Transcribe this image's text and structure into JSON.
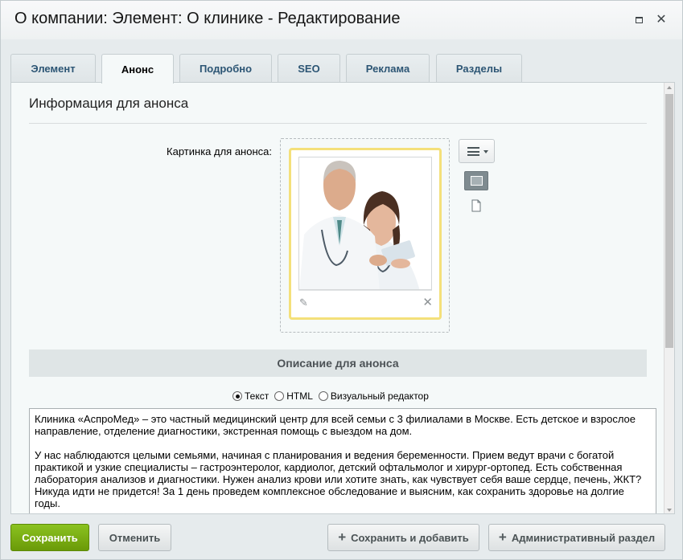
{
  "window": {
    "title": "О компании: Элемент: О клинике - Редактирование"
  },
  "tabs": [
    {
      "label": "Элемент",
      "active": false
    },
    {
      "label": "Анонс",
      "active": true
    },
    {
      "label": "Подробно",
      "active": false
    },
    {
      "label": "SEO",
      "active": false
    },
    {
      "label": "Реклама",
      "active": false
    },
    {
      "label": "Разделы",
      "active": false
    }
  ],
  "section": {
    "title": "Информация для анонса",
    "image_label": "Картинка для анонса:"
  },
  "description": {
    "header": "Описание для анонса",
    "modes": [
      {
        "label": "Текст",
        "checked": true
      },
      {
        "label": "HTML",
        "checked": false
      },
      {
        "label": "Визуальный редактор",
        "checked": false
      }
    ],
    "paragraphs": [
      "Клиника «АспроМед» – это частный медицинский центр для всей семьи с 3 филиалами в Москве. Есть детское и взрослое направление, отделение диагностики, экстренная помощь с выездом на дом.",
      "У нас наблюдаются целыми семьями, начиная с планирования и ведения беременности. Прием ведут врачи с богатой практикой и узкие специалисты – гастроэнтеролог, кардиолог, детский офтальмолог и хирург-ортопед. Есть собственная лаборатория анализов и диагностики. Нужен анализ крови или хотите знать, как чувствует себя ваше сердце, печень, ЖКТ? Никуда идти не придется! За 1 день проведем комплексное обследование и выясним, как сохранить здоровье на долгие годы."
    ]
  },
  "footer": {
    "save": "Сохранить",
    "cancel": "Отменить",
    "save_and_add": "Сохранить и добавить",
    "admin_section": "Административный раздел"
  },
  "colors": {
    "save_button": "#7aab12",
    "tab_text": "#2c5574",
    "image_card_border": "#f4e07a"
  }
}
